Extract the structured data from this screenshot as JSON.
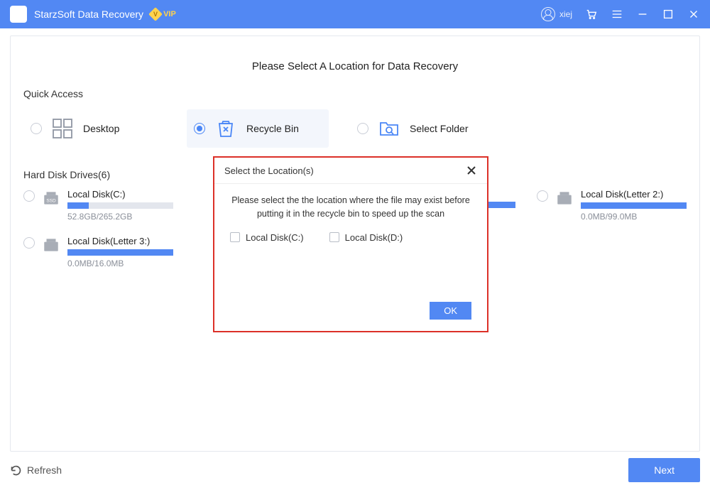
{
  "app": {
    "name": "StarzSoft Data Recovery",
    "vip": "VIP"
  },
  "user": {
    "name": "xiej"
  },
  "main": {
    "title": "Please Select A Location for Data Recovery",
    "quick_access_label": "Quick Access",
    "qa": {
      "desktop": "Desktop",
      "recycle": "Recycle Bin",
      "select_folder": "Select Folder"
    },
    "drives_label": "Hard Disk Drives(6)",
    "drives": [
      {
        "name": "Local Disk(C:)",
        "size": "52.8GB/265.2GB",
        "fill": 20
      },
      {
        "name": "Local Disk(Letter 2:)",
        "size": "0.0MB/99.0MB",
        "fill": 100
      },
      {
        "name": "Local Disk(Letter 3:)",
        "size": "0.0MB/16.0MB",
        "fill": 100
      }
    ],
    "progress_strip_fill": 100
  },
  "footer": {
    "refresh": "Refresh",
    "next": "Next"
  },
  "dialog": {
    "title": "Select the Location(s)",
    "message": "Please select the the location where the file may exist before putting it in the recycle bin to speed up the scan",
    "opt1": "Local Disk(C:)",
    "opt2": "Local Disk(D:)",
    "ok": "OK"
  }
}
